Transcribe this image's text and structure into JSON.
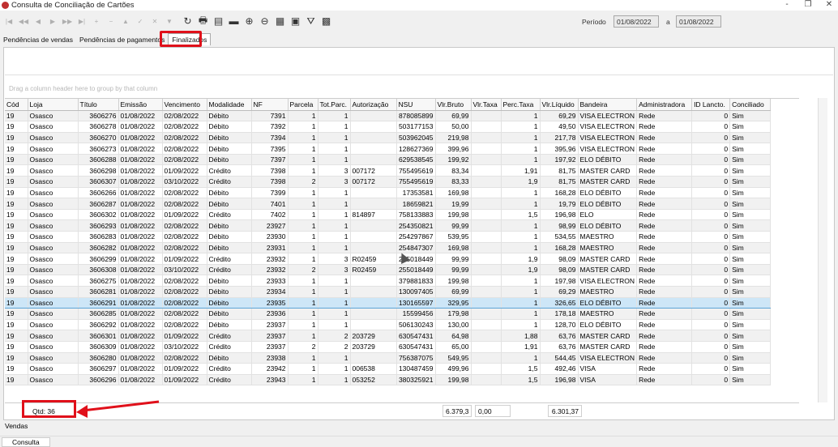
{
  "window": {
    "title": "Consulta de Conciliação de Cartões",
    "controls": [
      "-",
      "❐",
      "✕"
    ]
  },
  "toolbar": {
    "nav": [
      "|◀",
      "◀◀",
      "◀",
      "▶",
      "▶▶",
      "▶|",
      "+",
      "−",
      "▲",
      "✓",
      "✕",
      "▼"
    ],
    "tools": [
      {
        "name": "refresh-icon",
        "glyph": "↻"
      },
      {
        "name": "print-icon",
        "glyph": "🖶"
      },
      {
        "name": "report-icon",
        "glyph": "▤"
      },
      {
        "name": "folder-icon",
        "glyph": "▬"
      },
      {
        "name": "zoom-in-icon",
        "glyph": "⊕"
      },
      {
        "name": "zoom-out-icon",
        "glyph": "⊖"
      },
      {
        "name": "grid-icon",
        "glyph": "▦"
      },
      {
        "name": "export-icon",
        "glyph": "▣"
      },
      {
        "name": "filter-icon",
        "glyph": "⛛"
      },
      {
        "name": "excel-icon",
        "glyph": "▩"
      }
    ]
  },
  "filter": {
    "periodo_label": "Período",
    "date_from": "01/08/2022",
    "a_label": "a",
    "date_to": "01/08/2022"
  },
  "tabs": [
    {
      "label": "Pendências de vendas",
      "active": false
    },
    {
      "label": "Pendências de pagamentos",
      "active": false
    },
    {
      "label": "Finalizados",
      "active": true
    }
  ],
  "group_hint": "Drag a column header here to group by that column",
  "grid": {
    "columns": [
      "Cód",
      "Loja",
      "Título",
      "Emissão",
      "Vencimento",
      "Modalidade",
      "NF",
      "Parcela",
      "Tot.Parc.",
      "Autorização",
      "NSU",
      "Vlr.Bruto",
      "Vlr.Taxa",
      "Perc.Taxa",
      "Vlr.Líquido",
      "Bandeira",
      "Administradora",
      "ID Lancto.",
      "Conciliado"
    ],
    "selected_index": 17,
    "rows": [
      [
        "19",
        "Osasco",
        "3606276",
        "01/08/2022",
        "02/08/2022",
        "Débito",
        "7391",
        "1",
        "1",
        "",
        "878085899",
        "69,99",
        "",
        "1",
        "69,29",
        "VISA ELECTRON",
        "Rede",
        "0",
        "Sim"
      ],
      [
        "19",
        "Osasco",
        "3606278",
        "01/08/2022",
        "02/08/2022",
        "Débito",
        "7392",
        "1",
        "1",
        "",
        "503177153",
        "50,00",
        "",
        "1",
        "49,50",
        "VISA ELECTRON",
        "Rede",
        "0",
        "Sim"
      ],
      [
        "19",
        "Osasco",
        "3606270",
        "01/08/2022",
        "02/08/2022",
        "Débito",
        "7394",
        "1",
        "1",
        "",
        "503962045",
        "219,98",
        "",
        "1",
        "217,78",
        "VISA ELECTRON",
        "Rede",
        "0",
        "Sim"
      ],
      [
        "19",
        "Osasco",
        "3606273",
        "01/08/2022",
        "02/08/2022",
        "Débito",
        "7395",
        "1",
        "1",
        "",
        "128627369",
        "399,96",
        "",
        "1",
        "395,96",
        "VISA ELECTRON",
        "Rede",
        "0",
        "Sim"
      ],
      [
        "19",
        "Osasco",
        "3606288",
        "01/08/2022",
        "02/08/2022",
        "Débito",
        "7397",
        "1",
        "1",
        "",
        "629538545",
        "199,92",
        "",
        "1",
        "197,92",
        "ELO DÉBITO",
        "Rede",
        "0",
        "Sim"
      ],
      [
        "19",
        "Osasco",
        "3606298",
        "01/08/2022",
        "01/09/2022",
        "Crédito",
        "7398",
        "1",
        "3",
        "007172",
        "755495619",
        "83,34",
        "",
        "1,91",
        "81,75",
        "MASTER CARD",
        "Rede",
        "0",
        "Sim"
      ],
      [
        "19",
        "Osasco",
        "3606307",
        "01/08/2022",
        "03/10/2022",
        "Crédito",
        "7398",
        "2",
        "3",
        "007172",
        "755495619",
        "83,33",
        "",
        "1,9",
        "81,75",
        "MASTER CARD",
        "Rede",
        "0",
        "Sim"
      ],
      [
        "19",
        "Osasco",
        "3606266",
        "01/08/2022",
        "02/08/2022",
        "Débito",
        "7399",
        "1",
        "1",
        "",
        "17353581",
        "169,98",
        "",
        "1",
        "168,28",
        "ELO DÉBITO",
        "Rede",
        "0",
        "Sim"
      ],
      [
        "19",
        "Osasco",
        "3606287",
        "01/08/2022",
        "02/08/2022",
        "Débito",
        "7401",
        "1",
        "1",
        "",
        "18659821",
        "19,99",
        "",
        "1",
        "19,79",
        "ELO DÉBITO",
        "Rede",
        "0",
        "Sim"
      ],
      [
        "19",
        "Osasco",
        "3606302",
        "01/08/2022",
        "01/09/2022",
        "Crédito",
        "7402",
        "1",
        "1",
        "814897",
        "758133883",
        "199,98",
        "",
        "1,5",
        "196,98",
        "ELO",
        "Rede",
        "0",
        "Sim"
      ],
      [
        "19",
        "Osasco",
        "3606293",
        "01/08/2022",
        "02/08/2022",
        "Débito",
        "23927",
        "1",
        "1",
        "",
        "254350821",
        "99,99",
        "",
        "1",
        "98,99",
        "ELO DÉBITO",
        "Rede",
        "0",
        "Sim"
      ],
      [
        "19",
        "Osasco",
        "3606283",
        "01/08/2022",
        "02/08/2022",
        "Débito",
        "23930",
        "1",
        "1",
        "",
        "254297867",
        "539,95",
        "",
        "1",
        "534,55",
        "MAESTRO",
        "Rede",
        "0",
        "Sim"
      ],
      [
        "19",
        "Osasco",
        "3606282",
        "01/08/2022",
        "02/08/2022",
        "Débito",
        "23931",
        "1",
        "1",
        "",
        "254847307",
        "169,98",
        "",
        "1",
        "168,28",
        "MAESTRO",
        "Rede",
        "0",
        "Sim"
      ],
      [
        "19",
        "Osasco",
        "3606299",
        "01/08/2022",
        "01/09/2022",
        "Crédito",
        "23932",
        "1",
        "3",
        "R02459",
        "255018449",
        "99,99",
        "",
        "1,9",
        "98,09",
        "MASTER CARD",
        "Rede",
        "0",
        "Sim"
      ],
      [
        "19",
        "Osasco",
        "3606308",
        "01/08/2022",
        "03/10/2022",
        "Crédito",
        "23932",
        "2",
        "3",
        "R02459",
        "255018449",
        "99,99",
        "",
        "1,9",
        "98,09",
        "MASTER CARD",
        "Rede",
        "0",
        "Sim"
      ],
      [
        "19",
        "Osasco",
        "3606275",
        "01/08/2022",
        "02/08/2022",
        "Débito",
        "23933",
        "1",
        "1",
        "",
        "379881833",
        "199,98",
        "",
        "1",
        "197,98",
        "VISA ELECTRON",
        "Rede",
        "0",
        "Sim"
      ],
      [
        "19",
        "Osasco",
        "3606281",
        "01/08/2022",
        "02/08/2022",
        "Débito",
        "23934",
        "1",
        "1",
        "",
        "130097405",
        "69,99",
        "",
        "1",
        "69,29",
        "MAESTRO",
        "Rede",
        "0",
        "Sim"
      ],
      [
        "19",
        "Osasco",
        "3606291",
        "01/08/2022",
        "02/08/2022",
        "Débito",
        "23935",
        "1",
        "1",
        "",
        "130165597",
        "329,95",
        "",
        "1",
        "326,65",
        "ELO DÉBITO",
        "Rede",
        "0",
        "Sim"
      ],
      [
        "19",
        "Osasco",
        "3606285",
        "01/08/2022",
        "02/08/2022",
        "Débito",
        "23936",
        "1",
        "1",
        "",
        "15599456",
        "179,98",
        "",
        "1",
        "178,18",
        "MAESTRO",
        "Rede",
        "0",
        "Sim"
      ],
      [
        "19",
        "Osasco",
        "3606292",
        "01/08/2022",
        "02/08/2022",
        "Débito",
        "23937",
        "1",
        "1",
        "",
        "506130243",
        "130,00",
        "",
        "1",
        "128,70",
        "ELO DÉBITO",
        "Rede",
        "0",
        "Sim"
      ],
      [
        "19",
        "Osasco",
        "3606301",
        "01/08/2022",
        "01/09/2022",
        "Crédito",
        "23937",
        "1",
        "2",
        "203729",
        "630547431",
        "64,98",
        "",
        "1,88",
        "63,76",
        "MASTER CARD",
        "Rede",
        "0",
        "Sim"
      ],
      [
        "19",
        "Osasco",
        "3606309",
        "01/08/2022",
        "03/10/2022",
        "Crédito",
        "23937",
        "2",
        "2",
        "203729",
        "630547431",
        "65,00",
        "",
        "1,91",
        "63,76",
        "MASTER CARD",
        "Rede",
        "0",
        "Sim"
      ],
      [
        "19",
        "Osasco",
        "3606280",
        "01/08/2022",
        "02/08/2022",
        "Débito",
        "23938",
        "1",
        "1",
        "",
        "756387075",
        "549,95",
        "",
        "1",
        "544,45",
        "VISA ELECTRON",
        "Rede",
        "0",
        "Sim"
      ],
      [
        "19",
        "Osasco",
        "3606297",
        "01/08/2022",
        "01/09/2022",
        "Crédito",
        "23942",
        "1",
        "1",
        "006538",
        "130487459",
        "499,96",
        "",
        "1,5",
        "492,46",
        "VISA",
        "Rede",
        "0",
        "Sim"
      ],
      [
        "19",
        "Osasco",
        "3606296",
        "01/08/2022",
        "01/09/2022",
        "Crédito",
        "23943",
        "1",
        "1",
        "053252",
        "380325921",
        "199,98",
        "",
        "1,5",
        "196,98",
        "VISA",
        "Rede",
        "0",
        "Sim"
      ]
    ]
  },
  "footer": {
    "qtd": "Qtd: 36",
    "total_bruto": "6.379,3",
    "total_taxa": "0,00",
    "total_liquido": "6.301,37"
  },
  "bottom": {
    "vendas_label": "Vendas",
    "status_tab": "Consulta"
  },
  "annotation_color": "#e0101a"
}
